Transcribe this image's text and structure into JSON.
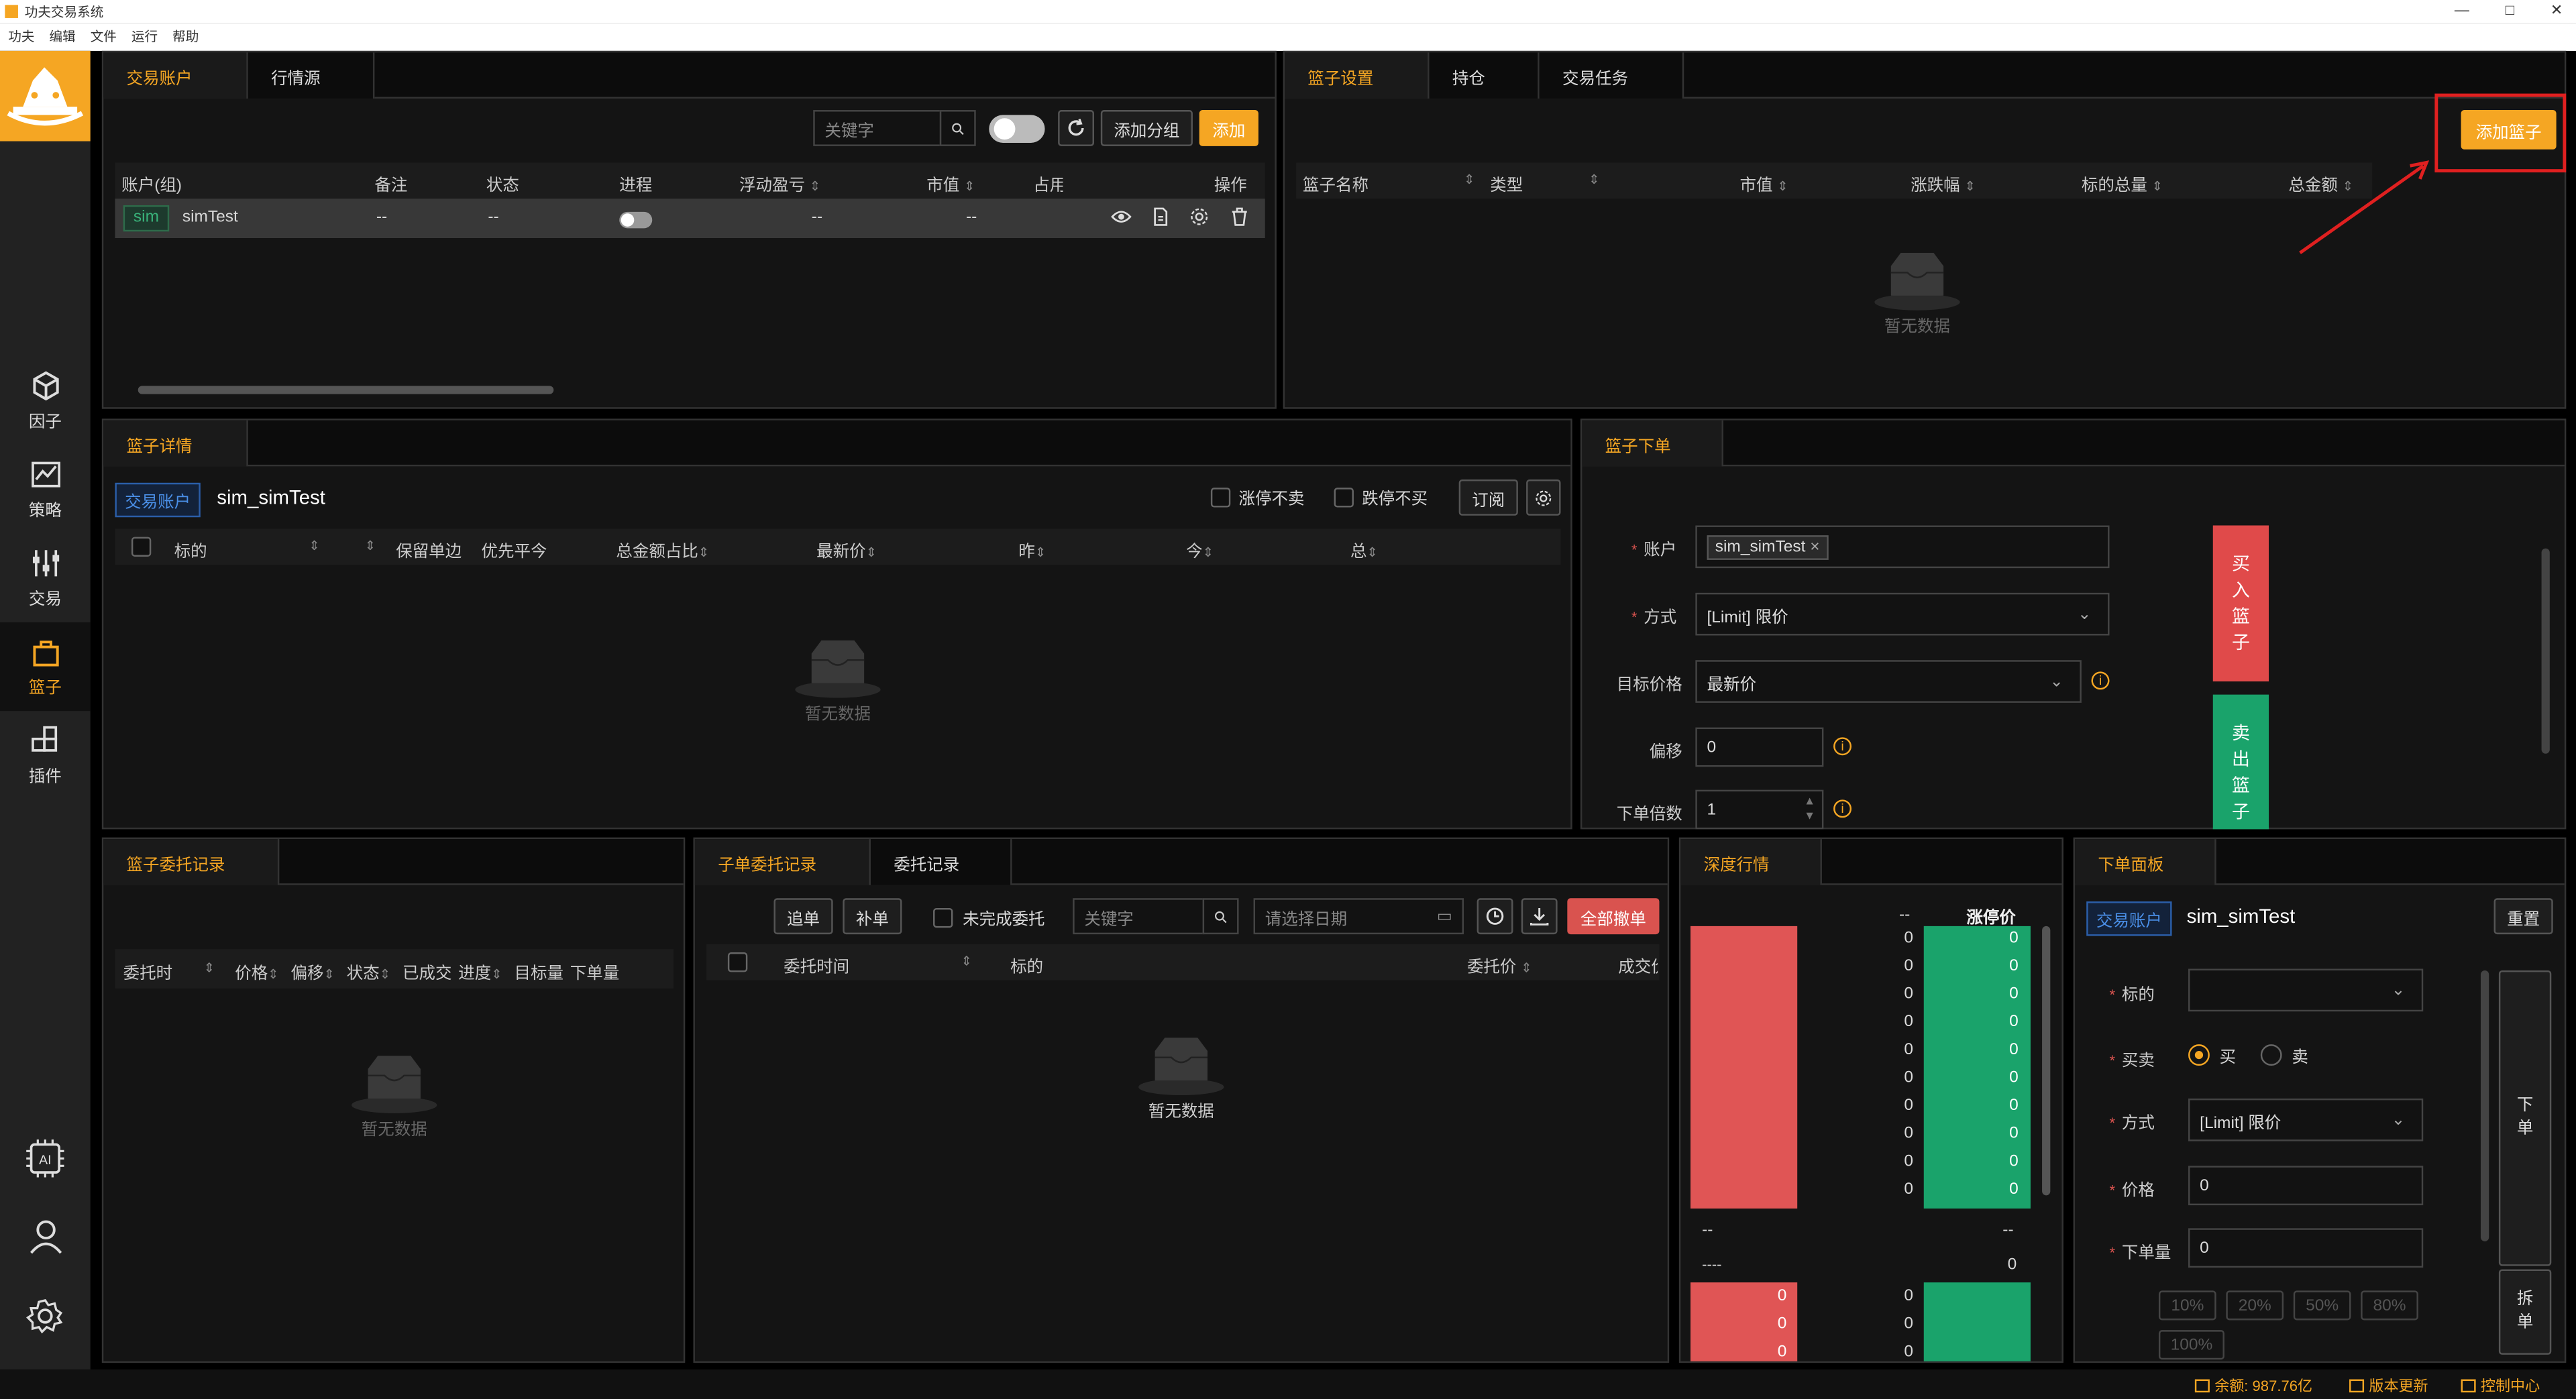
{
  "window": {
    "title": "功夫交易系统",
    "controls": [
      "—",
      "□",
      "✕"
    ]
  },
  "menu": [
    "功夫",
    "编辑",
    "文件",
    "运行",
    "帮助"
  ],
  "sidebar": {
    "items": [
      {
        "label": "因子",
        "icon": "cube-icon"
      },
      {
        "label": "策略",
        "icon": "chart-icon"
      },
      {
        "label": "交易",
        "icon": "sliders-icon"
      },
      {
        "label": "篮子",
        "icon": "basket-icon"
      },
      {
        "label": "插件",
        "icon": "plugin-icon"
      }
    ],
    "bottom": [
      "ai-chip-icon",
      "user-icon",
      "gear-icon"
    ]
  },
  "accounts": {
    "tabs": [
      "交易账户",
      "行情源"
    ],
    "search_placeholder": "关键字",
    "add_group": "添加分组",
    "add": "添加",
    "columns": [
      "账户(组)",
      "备注",
      "状态",
      "进程",
      "浮动盈亏",
      "市值",
      "占用",
      "操作"
    ],
    "rows": [
      {
        "tag": "sim",
        "name": "simTest",
        "remark": "--",
        "status": "--",
        "pnl": "--",
        "value": "--",
        "occupy": "--"
      }
    ]
  },
  "basket_settings": {
    "tabs": [
      "篮子设置",
      "持仓",
      "交易任务"
    ],
    "add_basket": "添加篮子",
    "columns": [
      "篮子名称",
      "类型",
      "市值",
      "涨跌幅",
      "标的总量",
      "总金额"
    ],
    "empty": "暂无数据"
  },
  "basket_detail": {
    "tab": "篮子详情",
    "account_tag": "交易账户",
    "account": "sim_simTest",
    "limit_up": "涨停不卖",
    "limit_down": "跌停不买",
    "subscribe": "订阅",
    "columns": [
      "标的",
      "保留单边",
      "优先平今",
      "总金额占比",
      "最新价",
      "昨",
      "今",
      "总"
    ],
    "empty": "暂无数据"
  },
  "basket_order": {
    "tab": "篮子下单",
    "account_label": "账户",
    "account_value": "sim_simTest",
    "method_label": "方式",
    "method_value": "[Limit] 限价",
    "target_price_label": "目标价格",
    "target_price_value": "最新价",
    "offset_label": "偏移",
    "offset_value": "0",
    "multiple_label": "下单倍数",
    "multiple_value": "1",
    "buy": [
      "买",
      "入",
      "篮",
      "子"
    ],
    "sell": [
      "卖",
      "出",
      "篮",
      "子"
    ]
  },
  "basket_records": {
    "tab": "篮子委托记录",
    "columns": [
      "委托时间",
      "价格",
      "偏移",
      "状态",
      "已成交",
      "进度",
      "目标量",
      "下单量"
    ],
    "empty": "暂无数据"
  },
  "sub_records": {
    "tabs": [
      "子单委托记录",
      "委托记录"
    ],
    "chase": "追单",
    "supplement": "补单",
    "unfinished": "未完成委托",
    "search_placeholder": "关键字",
    "date_placeholder": "请选择日期",
    "cancel_all": "全部撤单",
    "columns": [
      "委托时间",
      "标的",
      "委托价",
      "成交价"
    ],
    "empty": "暂无数据"
  },
  "depth": {
    "tab": "深度行情",
    "header_left": "--",
    "header_right": "涨停价",
    "bid_vols": [
      "0",
      "0",
      "0",
      "0",
      "0",
      "0",
      "0",
      "0",
      "0",
      "0"
    ],
    "ask_vols": [
      "0",
      "0",
      "0",
      "0",
      "0",
      "0",
      "0",
      "0",
      "0",
      "0"
    ],
    "mid_left": "--",
    "mid_right": "--",
    "mid_dash": "----",
    "mid_zero": "0",
    "bottom_red": [
      "0",
      "0",
      "0"
    ],
    "bottom_mid": [
      "0",
      "0",
      "0"
    ]
  },
  "order_panel": {
    "tab": "下单面板",
    "reset": "重置",
    "account_tag": "交易账户",
    "account": "sim_simTest",
    "symbol_label": "标的",
    "side_label": "买卖",
    "buy": "买",
    "sell": "卖",
    "method_label": "方式",
    "method_value": "[Limit] 限价",
    "price_label": "价格",
    "price_value": "0",
    "qty_label": "下单量",
    "qty_value": "0",
    "percents": [
      "10%",
      "20%",
      "50%",
      "80%",
      "100%"
    ],
    "submit": [
      "下",
      "单"
    ],
    "split": [
      "拆",
      "单"
    ]
  },
  "status": {
    "balance": "余额: 987.76亿",
    "version": "版本更新",
    "control": "控制中心"
  }
}
